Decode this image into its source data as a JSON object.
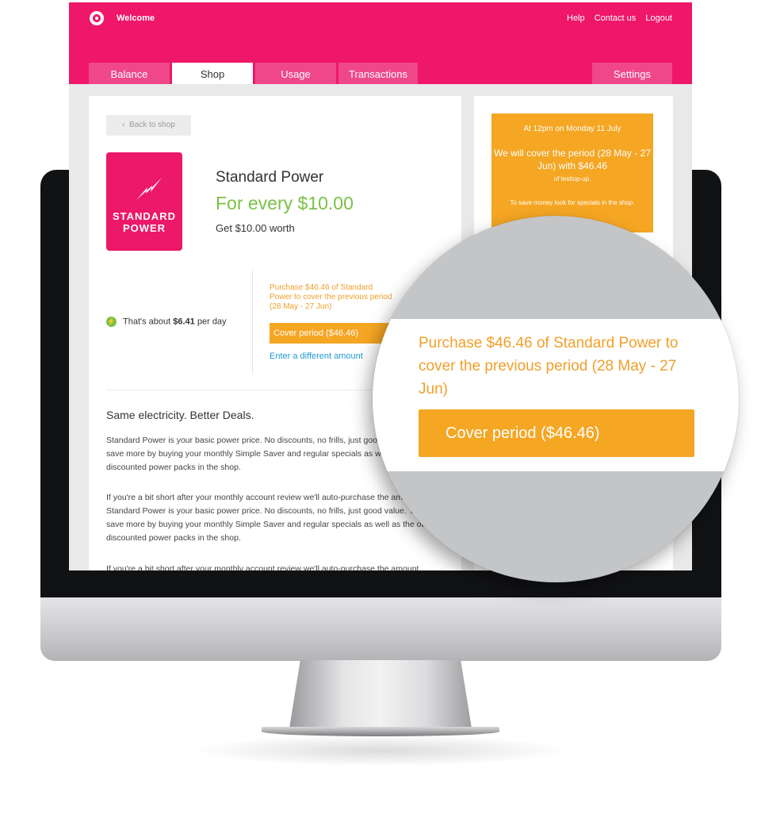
{
  "header": {
    "welcome": "Welcome",
    "links": [
      "Help",
      "Contact us",
      "Logout"
    ]
  },
  "tabs": [
    "Balance",
    "Shop",
    "Usage",
    "Transactions"
  ],
  "settings_tab": "Settings",
  "active_tab": "Shop",
  "back_button": "Back to shop",
  "product": {
    "tile_line1": "STANDARD",
    "tile_line2": "POWER",
    "name": "Standard Power",
    "price": "For every $10.00",
    "worth": "Get $10.00 worth"
  },
  "per_day": {
    "prefix": "That's about",
    "amount": "$6.41",
    "suffix": "per day"
  },
  "purchase": {
    "text": "Purchase $46.46 of Standard Power to cover the previous period (28 May - 27 Jun)",
    "button": "Cover period ($46.46)",
    "link": "Enter a different amount"
  },
  "info_box": {
    "line1": "At 12pm on Monday 11 July",
    "line2": "We will cover the period (28 May - 27 Jun) with $46.46",
    "line3": "of testtop-up.",
    "line4": "To save money look for specials in the shop."
  },
  "deals": {
    "title": "Same electricity. Better Deals.",
    "para1": "Standard Power is your basic power price. No discounts, no frills, just good value. You can save more by buying your monthly Simple Saver and regular specials as well as the other discounted power packs in the shop.",
    "para2": "If you're a bit short after your monthly account review we'll auto-purchase the amount. Standard Power is your basic power price. No discounts, no frills, just good value. You can save more by buying your monthly Simple Saver and regular specials as well as the other discounted power packs in the shop.",
    "para3": "If you're a bit short after your monthly account review we'll auto-purchase the amount"
  },
  "magnifier": {
    "text": "Purchase $46.46 of Standard Power to cover the previous period (28 May - 27 Jun)",
    "button": "Cover period ($46.46)"
  },
  "colors": {
    "brand_pink": "#ee1769",
    "accent_orange": "#f5a623",
    "price_green": "#7ac143",
    "link_blue": "#1e9bd7"
  }
}
